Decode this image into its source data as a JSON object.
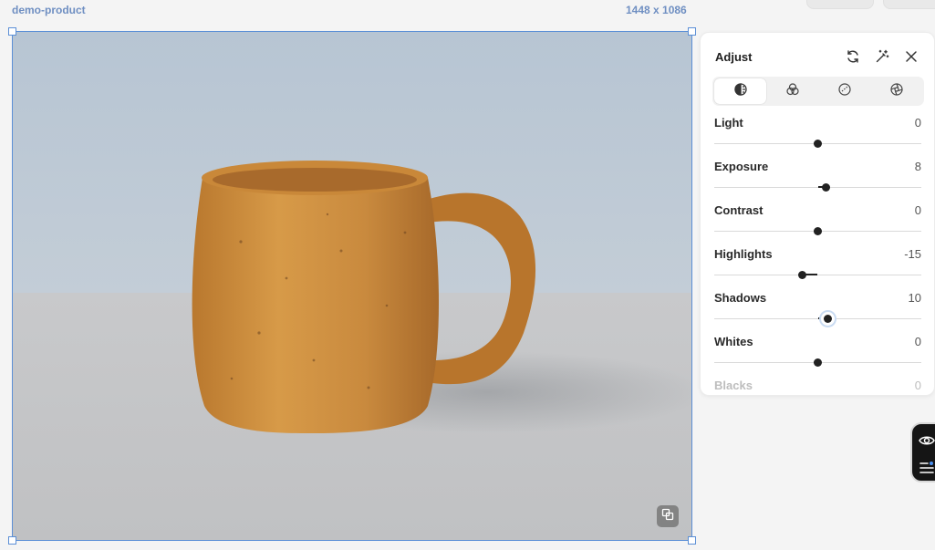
{
  "header": {
    "file_name": "demo-product",
    "dimensions": "1448 x 1086"
  },
  "colors": {
    "selection": "#5b8fd6",
    "label_blue": "#6f8fc2",
    "panel_bg": "#ffffff",
    "accent_dark": "#222222"
  },
  "canvas": {
    "compare_icon": "compare-icon"
  },
  "panel": {
    "title": "Adjust",
    "header_icons": [
      "reset-icon",
      "auto-magic-icon",
      "close-icon"
    ],
    "tabs": [
      {
        "icon": "light-icon",
        "active": true
      },
      {
        "icon": "color-icon",
        "active": false
      },
      {
        "icon": "effects-icon",
        "active": false
      },
      {
        "icon": "detail-icon",
        "active": false
      }
    ],
    "sliders": [
      {
        "label": "Light",
        "value": "0",
        "position": 0.5
      },
      {
        "label": "Exposure",
        "value": "8",
        "position": 0.54
      },
      {
        "label": "Contrast",
        "value": "0",
        "position": 0.5
      },
      {
        "label": "Highlights",
        "value": "-15",
        "position": 0.425
      },
      {
        "label": "Shadows",
        "value": "10",
        "position": 0.55
      },
      {
        "label": "Whites",
        "value": "0",
        "position": 0.5
      },
      {
        "label": "Blacks",
        "value": "0",
        "position": 0.5
      }
    ]
  },
  "side_widget": {
    "icons": [
      "eye-icon",
      "adjust-list-icon"
    ]
  }
}
